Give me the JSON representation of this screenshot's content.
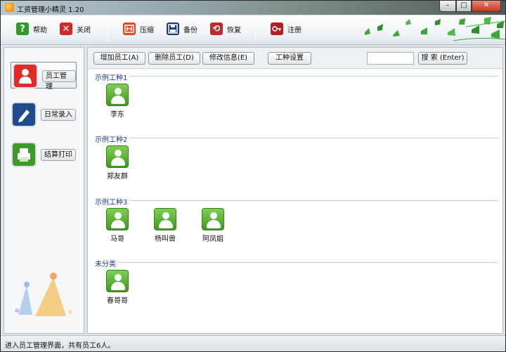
{
  "window": {
    "title": "工资管理小精灵 1.20"
  },
  "toolbar": {
    "help": {
      "label": "帮助",
      "icon": "question-icon",
      "color": "#2f9a2a"
    },
    "close": {
      "label": "关闭",
      "icon": "close-x-icon",
      "color": "#d02a2a"
    },
    "compress": {
      "label": "压缩",
      "icon": "compress-icon",
      "color": "#e04a1c"
    },
    "backup": {
      "label": "备份",
      "icon": "floppy-disk-icon",
      "color": "#1c3a78"
    },
    "restore": {
      "label": "恢复",
      "icon": "restore-arrows-icon",
      "color": "#c3282a"
    },
    "register": {
      "label": "注册",
      "icon": "key-icon",
      "color": "#b71e24"
    }
  },
  "sidebar": {
    "items": [
      {
        "label": "员工管理",
        "icon": "employee-manage-icon",
        "color": "#e02b2b",
        "active": true
      },
      {
        "label": "日常录入",
        "icon": "pencil-entry-icon",
        "color": "#1f4d8a",
        "active": false
      },
      {
        "label": "结算打印",
        "icon": "printer-icon",
        "color": "#3f9a2a",
        "active": false
      }
    ]
  },
  "actions": {
    "add": "增加员工(A)",
    "delete": "删除员工(D)",
    "edit": "修改信息(E)",
    "job_settings": "工种设置",
    "search_value": "",
    "search": "搜 索 (Enter)"
  },
  "categories": [
    {
      "name": "示例工种1",
      "employees": [
        "李东"
      ]
    },
    {
      "name": "示例工种2",
      "employees": [
        "郑友群"
      ]
    },
    {
      "name": "示例工种3",
      "employees": [
        "马哥",
        "杨叫兽",
        "阿凤姐"
      ]
    },
    {
      "name": "未分类",
      "employees": [
        "春哥哥"
      ]
    }
  ],
  "status": {
    "text": "进入员工管理界面，共有员工6人。"
  }
}
